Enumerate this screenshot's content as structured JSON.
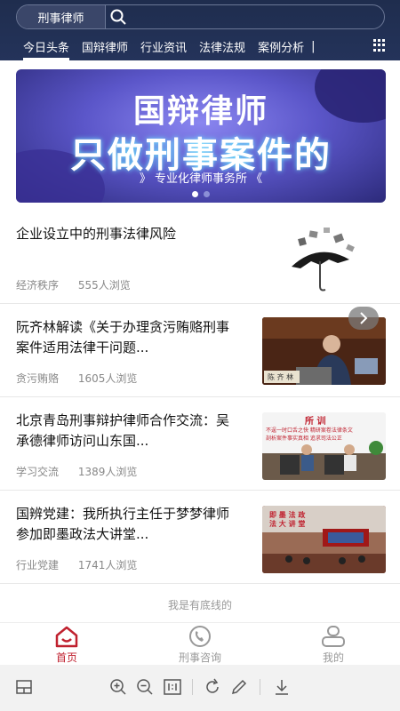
{
  "search": {
    "category": "刑事律师"
  },
  "tabs": [
    "今日头条",
    "国辩律师",
    "行业资讯",
    "法律法规",
    "案例分析"
  ],
  "tab_separator": "|",
  "banner": {
    "line1": "国辩律师",
    "line2": "只做刑事案件的",
    "line3": "》 专业化律师事务所 《"
  },
  "news": [
    {
      "title": "企业设立中的刑事法律风险",
      "category": "经济秩序",
      "views": "555人浏览"
    },
    {
      "title": "阮齐林解读《关于办理贪污贿赂刑事案件适用法律干问题...",
      "category": "贪污贿赂",
      "views": "1605人浏览"
    },
    {
      "title": "北京青岛刑事辩护律师合作交流：吴承德律师访问山东国...",
      "category": "学习交流",
      "views": "1389人浏览"
    },
    {
      "title": "国辨党建：我所执行主任于梦梦律师参加即墨政法大讲堂...",
      "category": "行业党建",
      "views": "1741人浏览"
    }
  ],
  "thumb_text": {
    "item2_sign": "陈 齐 林",
    "item3_banner": "所 训",
    "item3_sub": "不逞一时口舌之快  精研案卷法律条文",
    "item3_sub2": "剖析案件事实真相  追求司法公正",
    "item4_sign": "即 墨 法 政 法 大 讲 堂"
  },
  "footer_note": "我是有底线的",
  "tabbar": [
    {
      "label": "首页",
      "active": true
    },
    {
      "label": "刑事咨询",
      "active": false
    },
    {
      "label": "我的",
      "active": false
    }
  ],
  "colors": {
    "header": "#1f2d4e",
    "accent": "#c0212f",
    "muted": "#888888"
  }
}
